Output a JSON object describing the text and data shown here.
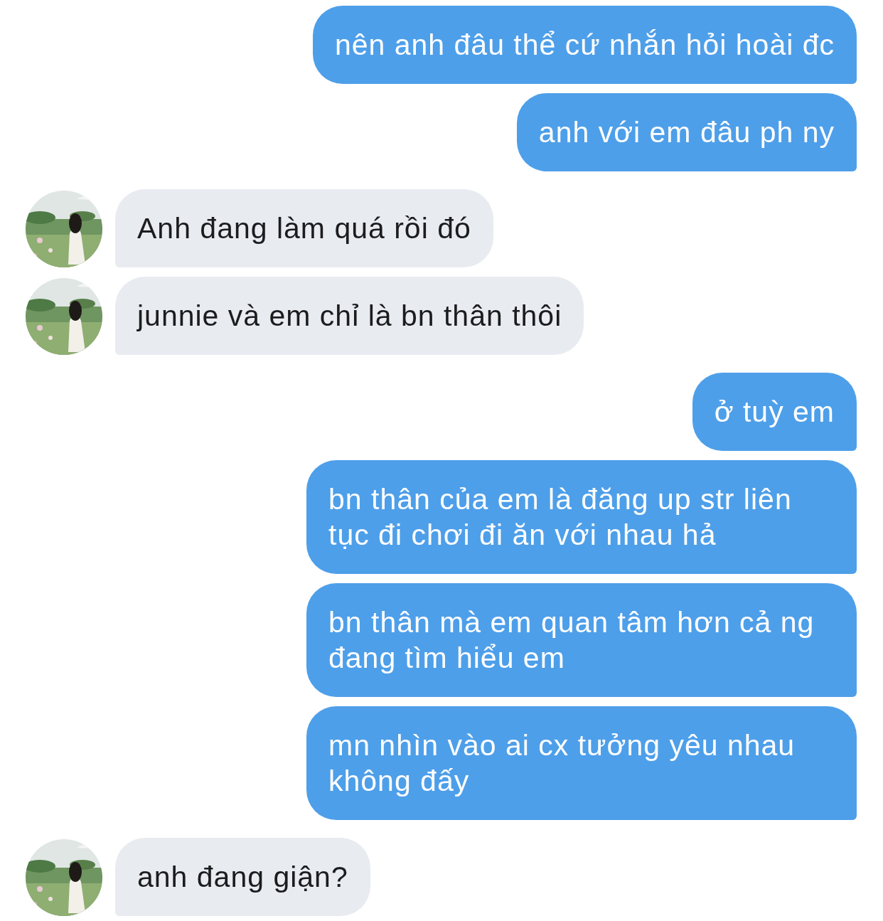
{
  "messages": [
    {
      "kind": "sent",
      "text": "nên anh đâu thể cứ nhắn hỏi hoài đc"
    },
    {
      "kind": "sent",
      "text": "anh với em đâu ph ny"
    },
    {
      "kind": "received",
      "text": "Anh đang làm quá rồi đó"
    },
    {
      "kind": "received",
      "text": "junnie và em chỉ là bn thân thôi"
    },
    {
      "kind": "sent",
      "text": "ở tuỳ em"
    },
    {
      "kind": "sent",
      "text": "bn thân của em là đăng up str liên tục đi chơi đi ăn với nhau hả"
    },
    {
      "kind": "sent",
      "text": "bn thân mà em quan tâm hơn cả ng đang tìm hiểu em"
    },
    {
      "kind": "sent",
      "text": "mn nhìn vào ai cx tưởng yêu nhau không đấy"
    },
    {
      "kind": "received",
      "text": "anh đang giận?"
    }
  ]
}
